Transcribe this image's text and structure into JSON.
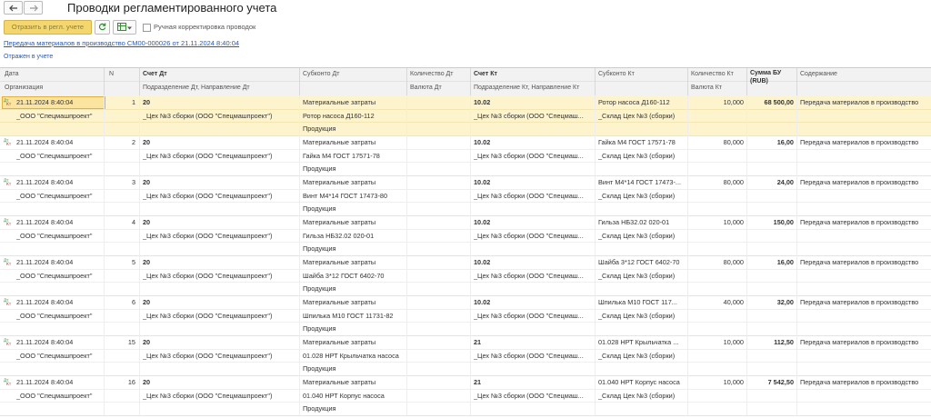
{
  "window": {
    "title": "Проводки регламентированного учета"
  },
  "toolbar": {
    "post_label": "Отразить в регл. учете",
    "manual_label": "Ручная корректировка проводок"
  },
  "doc_link": "Передача материалов в производство СМ00-000026 от 21.11.2024 8:40:04",
  "status": "Отражен в учете",
  "columns": {
    "date": "Дата",
    "n": "N",
    "acc_dt": "Счет Дт",
    "subconto_dt": "Субконто Дт",
    "qty_dt": "Количество Дт",
    "acc_kt": "Счет Кт",
    "subconto_kt": "Субконто Кт",
    "qty_kt": "Количество Кт",
    "sum": "Сумма БУ",
    "sum_cur": "(RUB)",
    "content": "Содержание",
    "org": "Организация",
    "dept_dt": "Подразделение Дт, Направление Дт",
    "cur_dt": "Валюта Дт",
    "dept_kt": "Подразделение Кт, Направление Кт",
    "cur_kt": "Валюта Кт"
  },
  "rows": [
    {
      "date": "21.11.2024 8:40:04",
      "n": "1",
      "acc_dt": "20",
      "org": "_ООО \"Спецмашпроект\"",
      "dept_dt": "_Цех №3 сборки (ООО \"Спецмашпроект\")",
      "sub_dt1": "Материальные затраты",
      "sub_dt2": "Ротор насоса Д160-112",
      "sub_dt3": "Продукция",
      "acc_kt": "10.02",
      "dept_kt": "_Цех №3 сборки (ООО \"Спецмаш...",
      "sub_kt1": "Ротор насоса Д160-112",
      "sub_kt2": "_Склад Цех №3 (сборки)",
      "qty_kt": "10,000",
      "sum": "68 500,00",
      "content": "Передача материалов в производство"
    },
    {
      "date": "21.11.2024 8:40:04",
      "n": "2",
      "acc_dt": "20",
      "org": "_ООО \"Спецмашпроект\"",
      "dept_dt": "_Цех №3 сборки (ООО \"Спецмашпроект\")",
      "sub_dt1": "Материальные затраты",
      "sub_dt2": "Гайка М4 ГОСТ 17571-78",
      "sub_dt3": "Продукция",
      "acc_kt": "10.02",
      "dept_kt": "_Цех №3 сборки (ООО \"Спецмаш...",
      "sub_kt1": "Гайка М4 ГОСТ 17571-78",
      "sub_kt2": "_Склад Цех №3 (сборки)",
      "qty_kt": "80,000",
      "sum": "16,00",
      "content": "Передача материалов в производство"
    },
    {
      "date": "21.11.2024 8:40:04",
      "n": "3",
      "acc_dt": "20",
      "org": "_ООО \"Спецмашпроект\"",
      "dept_dt": "_Цех №3 сборки (ООО \"Спецмашпроект\")",
      "sub_dt1": "Материальные затраты",
      "sub_dt2": "Винт М4*14 ГОСТ 17473-80",
      "sub_dt3": "Продукция",
      "acc_kt": "10.02",
      "dept_kt": "_Цех №3 сборки (ООО \"Спецмаш...",
      "sub_kt1": "Винт М4*14 ГОСТ 17473-...",
      "sub_kt2": "_Склад Цех №3 (сборки)",
      "qty_kt": "80,000",
      "sum": "24,00",
      "content": "Передача материалов в производство"
    },
    {
      "date": "21.11.2024 8:40:04",
      "n": "4",
      "acc_dt": "20",
      "org": "_ООО \"Спецмашпроект\"",
      "dept_dt": "_Цех №3 сборки (ООО \"Спецмашпроект\")",
      "sub_dt1": "Материальные затраты",
      "sub_dt2": "Гильза НБ32.02 020-01",
      "sub_dt3": "Продукция",
      "acc_kt": "10.02",
      "dept_kt": "_Цех №3 сборки (ООО \"Спецмаш...",
      "sub_kt1": "Гильза НБ32.02 020-01",
      "sub_kt2": "_Склад Цех №3 (сборки)",
      "qty_kt": "10,000",
      "sum": "150,00",
      "content": "Передача материалов в производство"
    },
    {
      "date": "21.11.2024 8:40:04",
      "n": "5",
      "acc_dt": "20",
      "org": "_ООО \"Спецмашпроект\"",
      "dept_dt": "_Цех №3 сборки (ООО \"Спецмашпроект\")",
      "sub_dt1": "Материальные затраты",
      "sub_dt2": "Шайба 3*12 ГОСТ 6402-70",
      "sub_dt3": "Продукция",
      "acc_kt": "10.02",
      "dept_kt": "_Цех №3 сборки (ООО \"Спецмаш...",
      "sub_kt1": "Шайба 3*12 ГОСТ 6402-70",
      "sub_kt2": "_Склад Цех №3 (сборки)",
      "qty_kt": "80,000",
      "sum": "16,00",
      "content": "Передача материалов в производство"
    },
    {
      "date": "21.11.2024 8:40:04",
      "n": "6",
      "acc_dt": "20",
      "org": "_ООО \"Спецмашпроект\"",
      "dept_dt": "_Цех №3 сборки (ООО \"Спецмашпроект\")",
      "sub_dt1": "Материальные затраты",
      "sub_dt2": "Шпилька М10 ГОСТ 11731-82",
      "sub_dt3": "Продукция",
      "acc_kt": "10.02",
      "dept_kt": "_Цех №3 сборки (ООО \"Спецмаш...",
      "sub_kt1": "Шпилька М10 ГОСТ 117...",
      "sub_kt2": "_Склад Цех №3 (сборки)",
      "qty_kt": "40,000",
      "sum": "32,00",
      "content": "Передача материалов в производство"
    },
    {
      "date": "21.11.2024 8:40:04",
      "n": "15",
      "acc_dt": "20",
      "org": "_ООО \"Спецмашпроект\"",
      "dept_dt": "_Цех №3 сборки (ООО \"Спецмашпроект\")",
      "sub_dt1": "Материальные затраты",
      "sub_dt2": "01.028 НРТ Крыльчатка насоса",
      "sub_dt3": "Продукция",
      "acc_kt": "21",
      "dept_kt": "_Цех №3 сборки (ООО \"Спецмаш...",
      "sub_kt1": "01.028 НРТ Крыльчатка ...",
      "sub_kt2": "_Склад Цех №3 (сборки)",
      "qty_kt": "10,000",
      "sum": "112,50",
      "content": "Передача материалов в производство"
    },
    {
      "date": "21.11.2024 8:40:04",
      "n": "16",
      "acc_dt": "20",
      "org": "_ООО \"Спецмашпроект\"",
      "dept_dt": "_Цех №3 сборки (ООО \"Спецмашпроект\")",
      "sub_dt1": "Материальные затраты",
      "sub_dt2": "01.040 НРТ Корпус насоса",
      "sub_dt3": "Продукция",
      "acc_kt": "21",
      "dept_kt": "_Цех №3 сборки (ООО \"Спецмаш...",
      "sub_kt1": "01.040 НРТ Корпус насоса",
      "sub_kt2": "_Склад Цех №3 (сборки)",
      "qty_kt": "10,000",
      "sum": "7 542,50",
      "content": "Передача материалов в производство"
    }
  ],
  "colors": {
    "accent": "#f4d66e",
    "selected_row": "#fdf3cc",
    "link": "#2a5ab0"
  },
  "icons": [
    "back-arrow-icon",
    "forward-arrow-icon",
    "refresh-icon",
    "dt-kt-icon",
    "checkbox-icon"
  ]
}
